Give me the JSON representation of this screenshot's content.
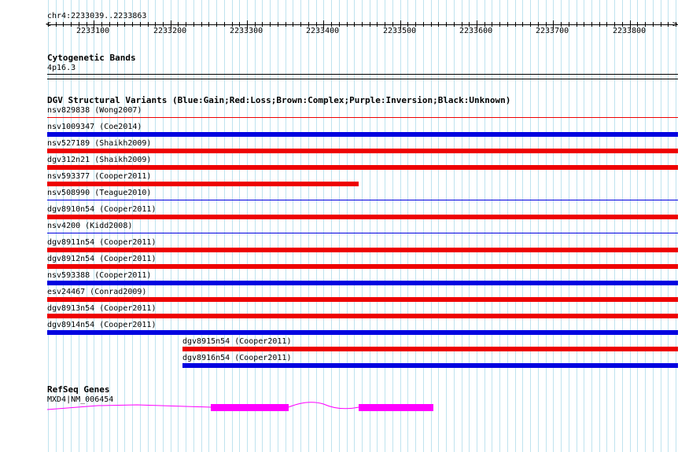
{
  "ruler": {
    "position": "chr4:2233039..2233863",
    "ticks": [
      {
        "label": "2233100",
        "coord": 2233100
      },
      {
        "label": "2233200",
        "coord": 2233200
      },
      {
        "label": "2233300",
        "coord": 2233300
      },
      {
        "label": "2233400",
        "coord": 2233400
      },
      {
        "label": "2233500",
        "coord": 2233500
      },
      {
        "label": "2233600",
        "coord": 2233600
      },
      {
        "label": "2233700",
        "coord": 2233700
      },
      {
        "label": "2233800",
        "coord": 2233800
      }
    ]
  },
  "view": {
    "start": 2233039,
    "end": 2233863
  },
  "cytobands": {
    "title": "Cytogenetic Bands",
    "band": "4p16.3"
  },
  "dgv": {
    "title": "DGV Structural Variants (Blue:Gain;Red:Loss;Brown:Complex;Purple:Inversion;Black:Unknown)",
    "colors": {
      "gain": "#0000e0",
      "loss": "#ee0000",
      "complex": "#a0522d",
      "inversion": "#800080",
      "unknown": "#000000"
    },
    "variants": [
      {
        "label": "nsv829838 (Wong2007)",
        "type": "loss",
        "style": "thin",
        "start": 2233039,
        "end": 2233863
      },
      {
        "label": "nsv1009347 (Coe2014)",
        "type": "gain",
        "style": "bar",
        "start": 2233039,
        "end": 2233863
      },
      {
        "label": "nsv527189 (Shaikh2009)",
        "type": "loss",
        "style": "bar",
        "start": 2233039,
        "end": 2233863
      },
      {
        "label": "dgv312n21 (Shaikh2009)",
        "type": "loss",
        "style": "bar",
        "start": 2233039,
        "end": 2233863
      },
      {
        "label": "nsv593377 (Cooper2011)",
        "type": "loss",
        "style": "bar",
        "start": 2233039,
        "end": 2233446
      },
      {
        "label": "nsv508990 (Teague2010)",
        "type": "gain",
        "style": "thin",
        "start": 2233039,
        "end": 2233863
      },
      {
        "label": "dgv8910n54 (Cooper2011)",
        "type": "loss",
        "style": "bar",
        "start": 2233039,
        "end": 2233863
      },
      {
        "label": "nsv4200 (Kidd2008)",
        "type": "gain",
        "style": "thin",
        "start": 2233039,
        "end": 2233863
      },
      {
        "label": "dgv8911n54 (Cooper2011)",
        "type": "loss",
        "style": "bar",
        "start": 2233039,
        "end": 2233863
      },
      {
        "label": "dgv8912n54 (Cooper2011)",
        "type": "loss",
        "style": "bar",
        "start": 2233039,
        "end": 2233863
      },
      {
        "label": "nsv593388 (Cooper2011)",
        "type": "gain",
        "style": "bar",
        "start": 2233039,
        "end": 2233863
      },
      {
        "label": "esv24467 (Conrad2009)",
        "type": "loss",
        "style": "bar",
        "start": 2233039,
        "end": 2233863
      },
      {
        "label": "dgv8913n54 (Cooper2011)",
        "type": "loss",
        "style": "bar",
        "start": 2233039,
        "end": 2233863
      },
      {
        "label": "dgv8914n54 (Cooper2011)",
        "type": "gain",
        "style": "bar",
        "start": 2233039,
        "end": 2233863
      },
      {
        "label": "dgv8915n54 (Cooper2011)",
        "type": "loss",
        "style": "bar",
        "start": 2233216,
        "end": 2233863
      },
      {
        "label": "dgv8916n54 (Cooper2011)",
        "type": "gain",
        "style": "bar",
        "start": 2233216,
        "end": 2233863
      }
    ]
  },
  "refseq": {
    "title": "RefSeq Genes",
    "gene_label": "MXD4|NM_006454",
    "color": "#ff00ff",
    "exons": [
      {
        "start": 2233253,
        "end": 2233354
      },
      {
        "start": 2233446,
        "end": 2233543
      }
    ]
  }
}
